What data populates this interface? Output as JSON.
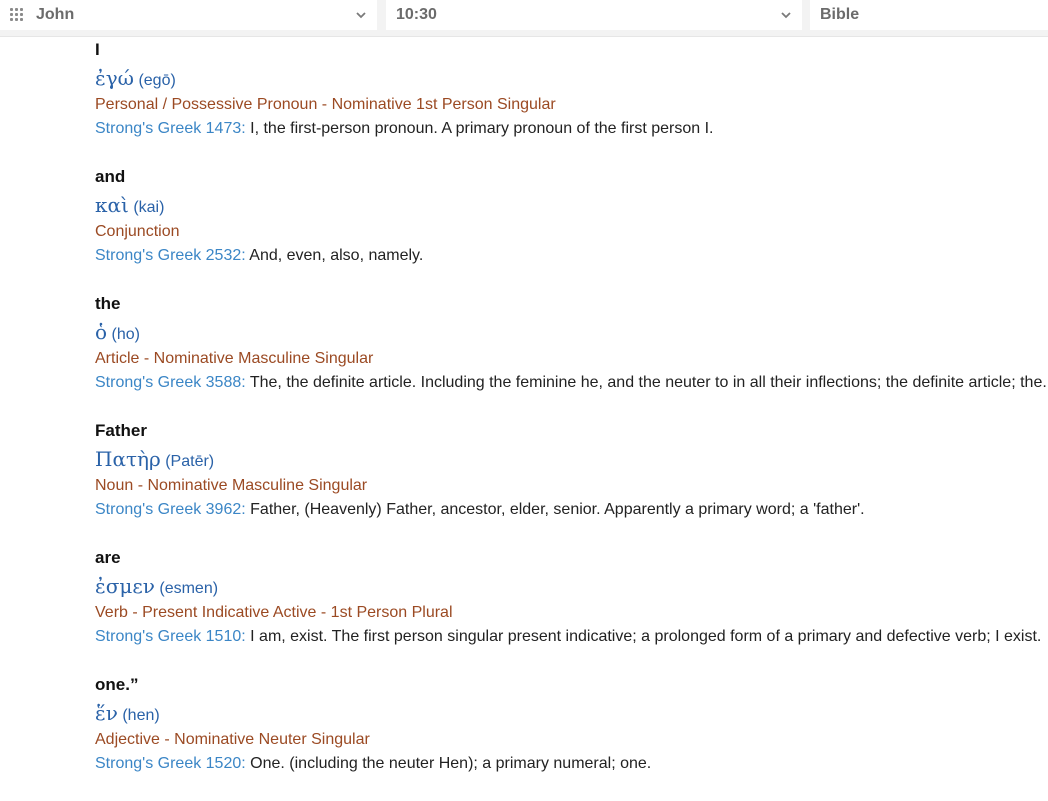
{
  "toolbar": {
    "book": "John",
    "chapter_verse": "10:30",
    "version": "Bible"
  },
  "entries": [
    {
      "english": "I",
      "greek": "ἐγώ",
      "translit": "(egō)",
      "parsing": "Personal / Possessive Pronoun - Nominative 1st Person Singular",
      "strongs_ref": "Strong's Greek 1473:",
      "definition": " I, the first-person pronoun. A primary pronoun of the first person I."
    },
    {
      "english": "and",
      "greek": "καὶ",
      "translit": "(kai)",
      "parsing": "Conjunction",
      "strongs_ref": "Strong's Greek 2532:",
      "definition": " And, even, also, namely."
    },
    {
      "english": "the",
      "greek": "ὁ",
      "translit": "(ho)",
      "parsing": "Article - Nominative Masculine Singular",
      "strongs_ref": "Strong's Greek 3588:",
      "definition": " The, the definite article. Including the feminine he, and the neuter to in all their inflections; the definite article; the."
    },
    {
      "english": "Father",
      "greek": "Πατὴρ",
      "translit": "(Patēr)",
      "parsing": "Noun - Nominative Masculine Singular",
      "strongs_ref": "Strong's Greek 3962:",
      "definition": " Father, (Heavenly) Father, ancestor, elder, senior. Apparently a primary word; a 'father'."
    },
    {
      "english": "are",
      "greek": "ἐσμεν",
      "translit": "(esmen)",
      "parsing": "Verb - Present Indicative Active - 1st Person Plural",
      "strongs_ref": "Strong's Greek 1510:",
      "definition": " I am, exist. The first person singular present indicative; a prolonged form of a primary and defective verb; I exist."
    },
    {
      "english": "one.”",
      "greek": "ἕν",
      "translit": "(hen)",
      "parsing": "Adjective - Nominative Neuter Singular",
      "strongs_ref": "Strong's Greek 1520:",
      "definition": " One. (including the neuter Hen); a primary numeral; one."
    }
  ]
}
